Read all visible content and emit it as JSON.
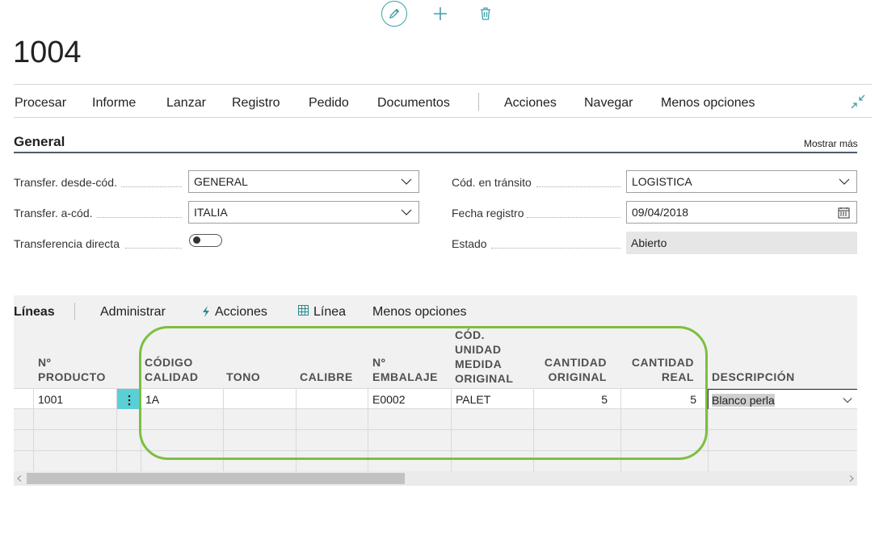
{
  "page": {
    "title": "1004",
    "toolbar_icons": [
      "pencil-icon",
      "plus-icon",
      "trash-icon"
    ]
  },
  "actions": {
    "items": [
      "Procesar",
      "Informe",
      "Lanzar",
      "Registro",
      "Pedido",
      "Documentos",
      "Acciones",
      "Navegar",
      "Menos opciones"
    ]
  },
  "general": {
    "title": "General",
    "show_more": "Mostrar más",
    "fields": {
      "from_code": {
        "label": "Transfer. desde-cód.",
        "value": "GENERAL"
      },
      "to_code": {
        "label": "Transfer. a-cód.",
        "value": "ITALIA"
      },
      "direct": {
        "label": "Transferencia directa",
        "value": "off"
      },
      "transit_code": {
        "label": "Cód. en tránsito",
        "value": "LOGISTICA"
      },
      "posting_date": {
        "label": "Fecha registro",
        "value": "09/04/2018"
      },
      "status": {
        "label": "Estado",
        "value": "Abierto"
      }
    }
  },
  "lines": {
    "title": "Líneas",
    "menu": [
      "Administrar",
      "Acciones",
      "Línea",
      "Menos opciones"
    ],
    "headers": {
      "producto": [
        "Nº",
        "PRODUCTO"
      ],
      "calidad": [
        "CÓDIGO",
        "CALIDAD"
      ],
      "tono": [
        "TONO"
      ],
      "calibre": [
        "CALIBRE"
      ],
      "embalaje": [
        "Nº",
        "EMBALAJE"
      ],
      "unidad": [
        "CÓD.",
        "UNIDAD",
        "MEDIDA",
        "ORIGINAL"
      ],
      "cant_orig": [
        "CANTIDAD",
        "ORIGINAL"
      ],
      "cant_real": [
        "CANTIDAD",
        "REAL"
      ],
      "descripcion": [
        "DESCRIPCIÓN"
      ]
    },
    "rows": [
      {
        "producto": "1001",
        "calidad": "1A",
        "tono": "",
        "calibre": "",
        "embalaje": "E0002",
        "unidad": "PALET",
        "cant_orig": "5",
        "cant_real": "5",
        "descripcion": "Blanco perla"
      }
    ]
  },
  "colors": {
    "accent": "#3f9fa8",
    "highlight_ring": "#7cbf40",
    "row_menu": "#5bcfd6"
  }
}
